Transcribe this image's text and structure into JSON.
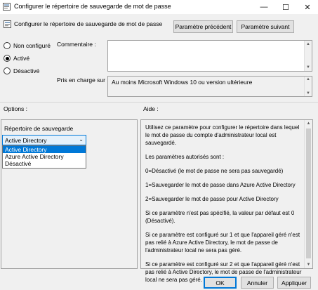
{
  "window": {
    "title": "Configurer le répertoire de sauvegarde de mot de passe",
    "icon": "policy-settings-icon",
    "controls": {
      "minimize": "—",
      "maximize": "☐",
      "close": "✕"
    }
  },
  "header": {
    "setting_name": "Configurer le répertoire de sauvegarde de mot de passe",
    "prev_button": "Paramètre précédent",
    "next_button": "Paramètre suivant"
  },
  "state_options": [
    {
      "label": "Non configuré",
      "selected": false
    },
    {
      "label": "Activé",
      "selected": true
    },
    {
      "label": "Désactivé",
      "selected": false
    }
  ],
  "comment": {
    "label": "Commentaire :",
    "value": ""
  },
  "supported": {
    "label": "Pris en charge sur :",
    "value": "Au moins Microsoft Windows 10 ou version ultérieure"
  },
  "options": {
    "heading": "Options :",
    "backup_label": "Répertoire de sauvegarde",
    "dropdown_value": "Active Directory",
    "dropdown_items": [
      "Active Directory",
      "Azure Active Directory",
      "Désactivé"
    ],
    "highlighted_item": 0
  },
  "help": {
    "heading": "Aide :",
    "paragraphs": [
      "Utilisez ce paramètre pour configurer le répertoire dans lequel le mot de passe du compte d'administrateur local est sauvegardé.",
      "Les paramètres autorisés sont :",
      "0=Désactivé (le mot de passe ne sera pas sauvegardé)",
      "1=Sauvegarder le mot de passe dans Azure Active Directory",
      "2=Sauvegarder le mot de passe pour Active Directory",
      "Si ce paramètre n'est pas spécifié, la valeur par défaut est 0 (Désactivé).",
      "Si ce paramètre est configuré sur 1 et que l'appareil géré n'est pas relié à Azure Active Directory, le mot de passe de l'administrateur local ne sera pas géré.",
      "Si ce paramètre est configuré sur 2 et que l'appareil géré n'est pas relié à Active Directory, le mot de passe de l'administrateur local ne sera pas géré."
    ]
  },
  "footer": {
    "ok": "OK",
    "cancel": "Annuler",
    "apply": "Appliquer"
  }
}
